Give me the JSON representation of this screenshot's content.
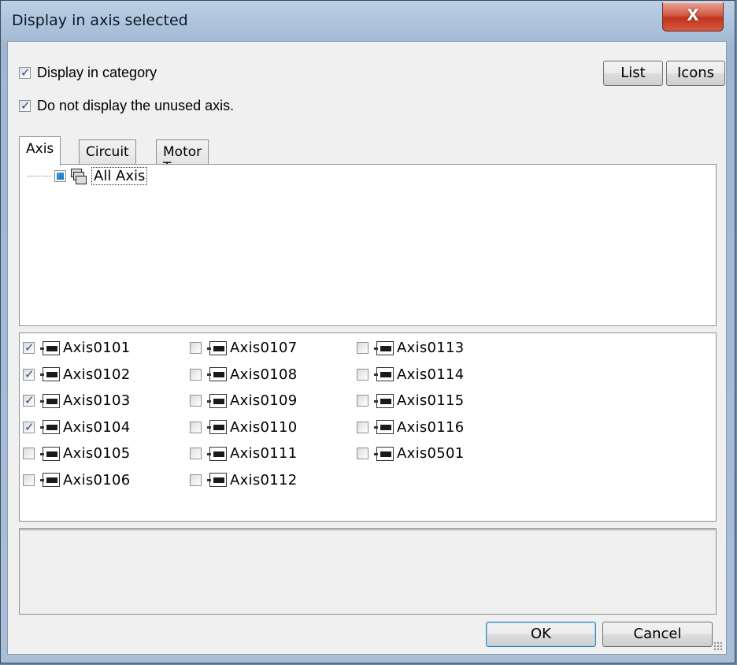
{
  "window": {
    "title": "Display in axis selected",
    "close_glyph": "X"
  },
  "options": {
    "display_in_category": {
      "label": "Display in category",
      "checked": true
    },
    "hide_unused_axis": {
      "label": "Do not display the unused axis.",
      "checked": true
    }
  },
  "view_buttons": {
    "list": "List",
    "icons": "Icons"
  },
  "tabs": [
    {
      "label": "Axis",
      "active": true
    },
    {
      "label": "Circuit",
      "active": false
    },
    {
      "label": "Motor Type",
      "active": false
    }
  ],
  "tree": {
    "root_label": "All Axis"
  },
  "axes": [
    {
      "label": "Axis0101",
      "checked": true
    },
    {
      "label": "Axis0102",
      "checked": true
    },
    {
      "label": "Axis0103",
      "checked": true
    },
    {
      "label": "Axis0104",
      "checked": true
    },
    {
      "label": "Axis0105",
      "checked": false
    },
    {
      "label": "Axis0106",
      "checked": false
    },
    {
      "label": "Axis0107",
      "checked": false
    },
    {
      "label": "Axis0108",
      "checked": false
    },
    {
      "label": "Axis0109",
      "checked": false
    },
    {
      "label": "Axis0110",
      "checked": false
    },
    {
      "label": "Axis0111",
      "checked": false
    },
    {
      "label": "Axis0112",
      "checked": false
    },
    {
      "label": "Axis0113",
      "checked": false
    },
    {
      "label": "Axis0114",
      "checked": false
    },
    {
      "label": "Axis0115",
      "checked": false
    },
    {
      "label": "Axis0116",
      "checked": false
    },
    {
      "label": "Axis0501",
      "checked": false
    }
  ],
  "footer": {
    "ok": "OK",
    "cancel": "Cancel"
  },
  "colors": {
    "title_bar": "#a9bfd8",
    "close_button": "#c0341e",
    "dialog_bg": "#f0f0f0",
    "check_mark": "#2a4d86"
  },
  "icons": {
    "close": "close-icon",
    "tree_node": "axis-group-icon",
    "axis": "motor-icon",
    "tree_state": "partial-check"
  }
}
